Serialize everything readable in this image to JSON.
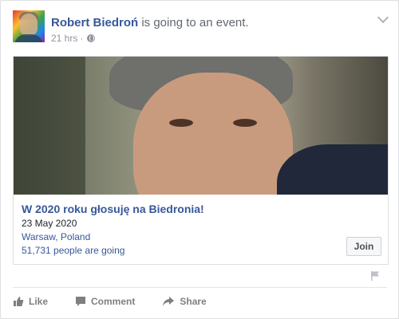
{
  "post": {
    "author": "Robert Biedroń",
    "action": "is going to an event.",
    "time": "21 hrs",
    "separator": "·",
    "privacy_icon": "globe-icon"
  },
  "event": {
    "title": "W 2020 roku głosuję na Biedronia!",
    "date": "23 May 2020",
    "location": "Warsaw, Poland",
    "going": "51,731 people are going",
    "join_label": "Join"
  },
  "actions": {
    "like": "Like",
    "comment": "Comment",
    "share": "Share"
  },
  "colors": {
    "link": "#365899",
    "meta": "#90949c",
    "action_text": "#7f7f7f"
  }
}
